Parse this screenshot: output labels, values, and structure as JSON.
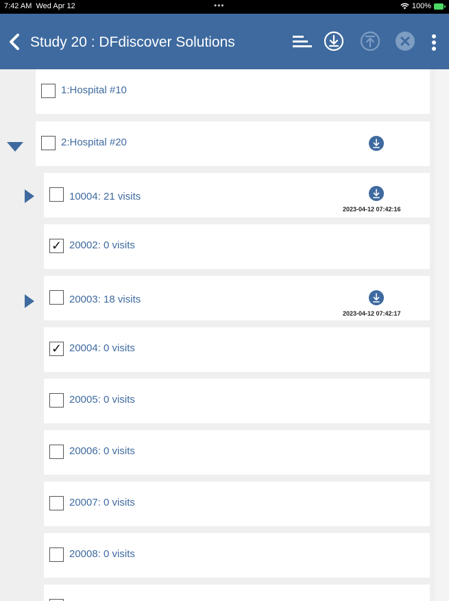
{
  "status_bar": {
    "time": "7:42 AM",
    "date": "Wed Apr 12",
    "dots": "•••",
    "battery": "100%"
  },
  "nav": {
    "title": "Study 20 : DFdiscover Solutions"
  },
  "rows": [
    {
      "label": "1:Hospital #10",
      "checked": false
    },
    {
      "label": "2:Hospital #20",
      "checked": false
    },
    {
      "label": "10004: 21 visits",
      "checked": false,
      "timestamp": "2023-04-12 07:42:16"
    },
    {
      "label": "20002: 0 visits",
      "checked": true
    },
    {
      "label": "20003: 18 visits",
      "checked": false,
      "timestamp": "2023-04-12 07:42:17"
    },
    {
      "label": "20004: 0 visits",
      "checked": true
    },
    {
      "label": "20005: 0 visits",
      "checked": false
    },
    {
      "label": "20006: 0 visits",
      "checked": false
    },
    {
      "label": "20007: 0 visits",
      "checked": false
    },
    {
      "label": "20008: 0 visits",
      "checked": false
    }
  ],
  "check_mark": "✓",
  "colors": {
    "nav": "#3e6a9f",
    "accent": "#3e6a9f",
    "background": "#efefef"
  }
}
